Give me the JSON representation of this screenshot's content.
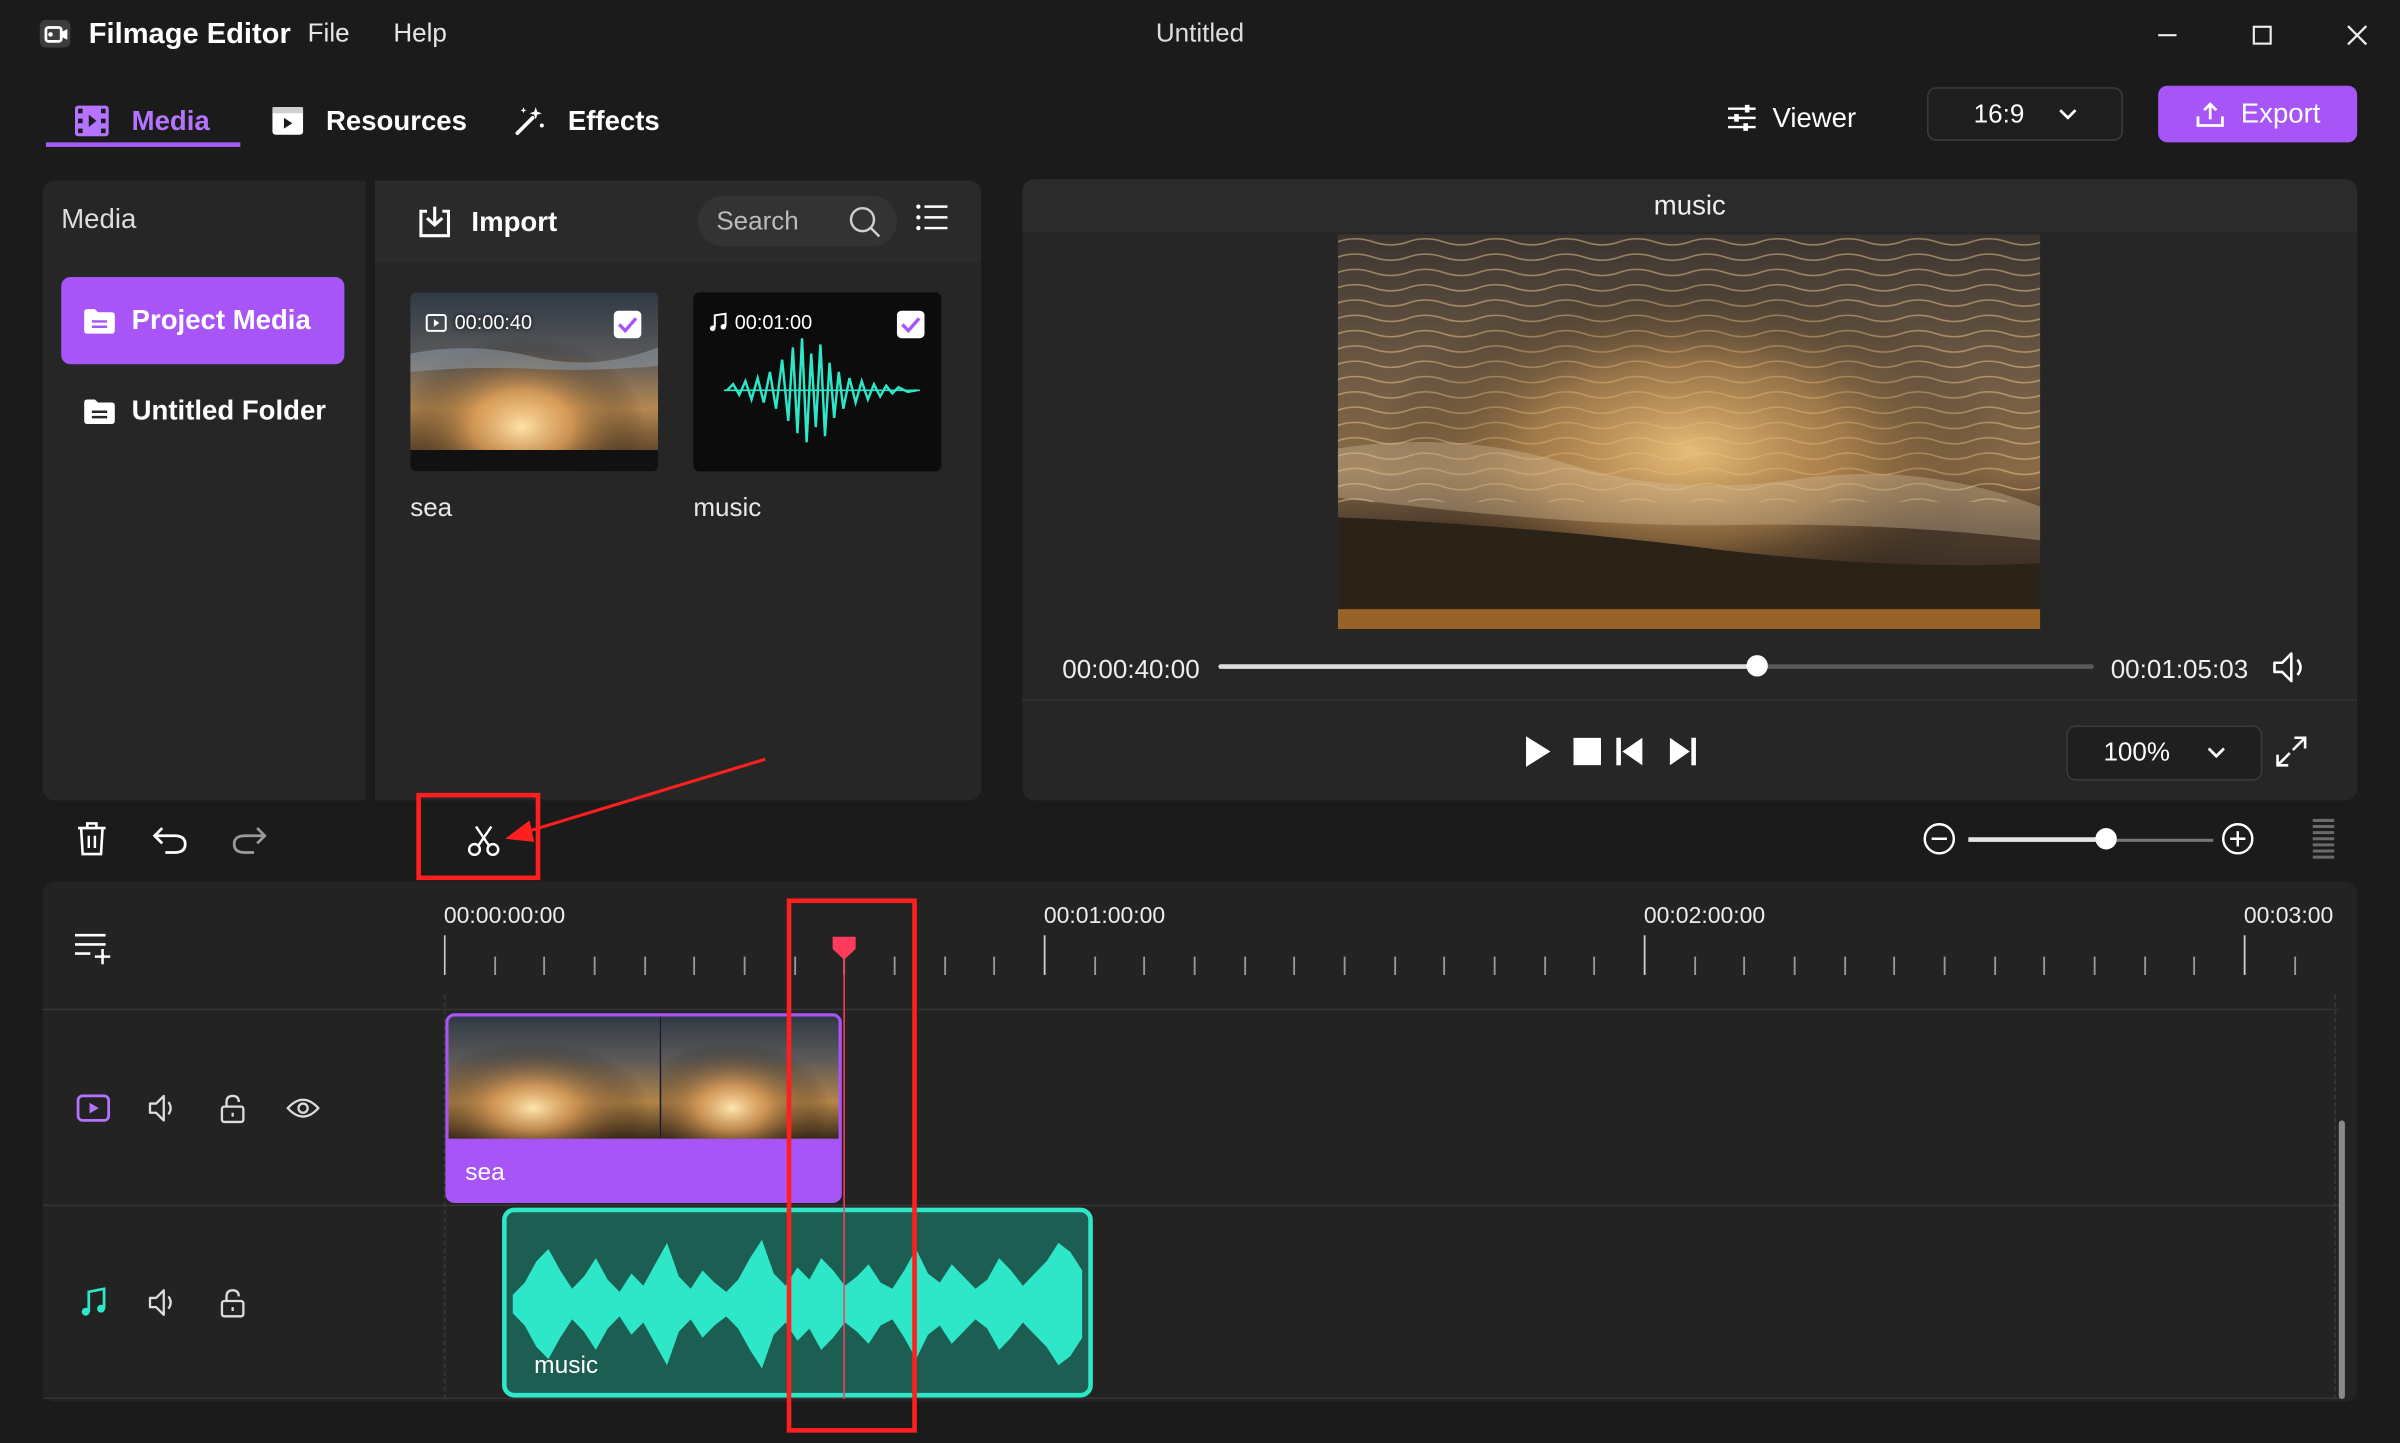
{
  "app": {
    "name": "Filmage Editor",
    "window_title": "Untitled"
  },
  "menu": {
    "file": "File",
    "help": "Help"
  },
  "tabs": {
    "media": "Media",
    "resources": "Resources",
    "effects": "Effects"
  },
  "header": {
    "viewer_label": "Viewer",
    "aspect_ratio": "16:9",
    "export_label": "Export"
  },
  "sidebar": {
    "title": "Media",
    "items": [
      {
        "label": "Project Media"
      },
      {
        "label": "Untitled Folder"
      }
    ]
  },
  "media_toolbar": {
    "import_label": "Import",
    "search_placeholder": "Search"
  },
  "media_items": [
    {
      "name": "sea",
      "duration": "00:00:40",
      "type": "video"
    },
    {
      "name": "music",
      "duration": "00:01:00",
      "type": "audio"
    }
  ],
  "viewer": {
    "title": "music",
    "current_time": "00:00:40:00",
    "total_time": "00:01:05:03",
    "progress": 0.615,
    "zoom": "100%"
  },
  "timeline": {
    "ruler_labels": [
      "00:00:00:00",
      "00:01:00:00",
      "00:02:00:00",
      "00:03:00"
    ],
    "zoom_level": 0.56,
    "clips": {
      "video": "sea",
      "audio": "music"
    }
  },
  "colors": {
    "accent": "#a855f7",
    "audio_clip": "#2ee6c8",
    "playhead": "#ff3b5c",
    "annotation": "#ff1f1f"
  }
}
